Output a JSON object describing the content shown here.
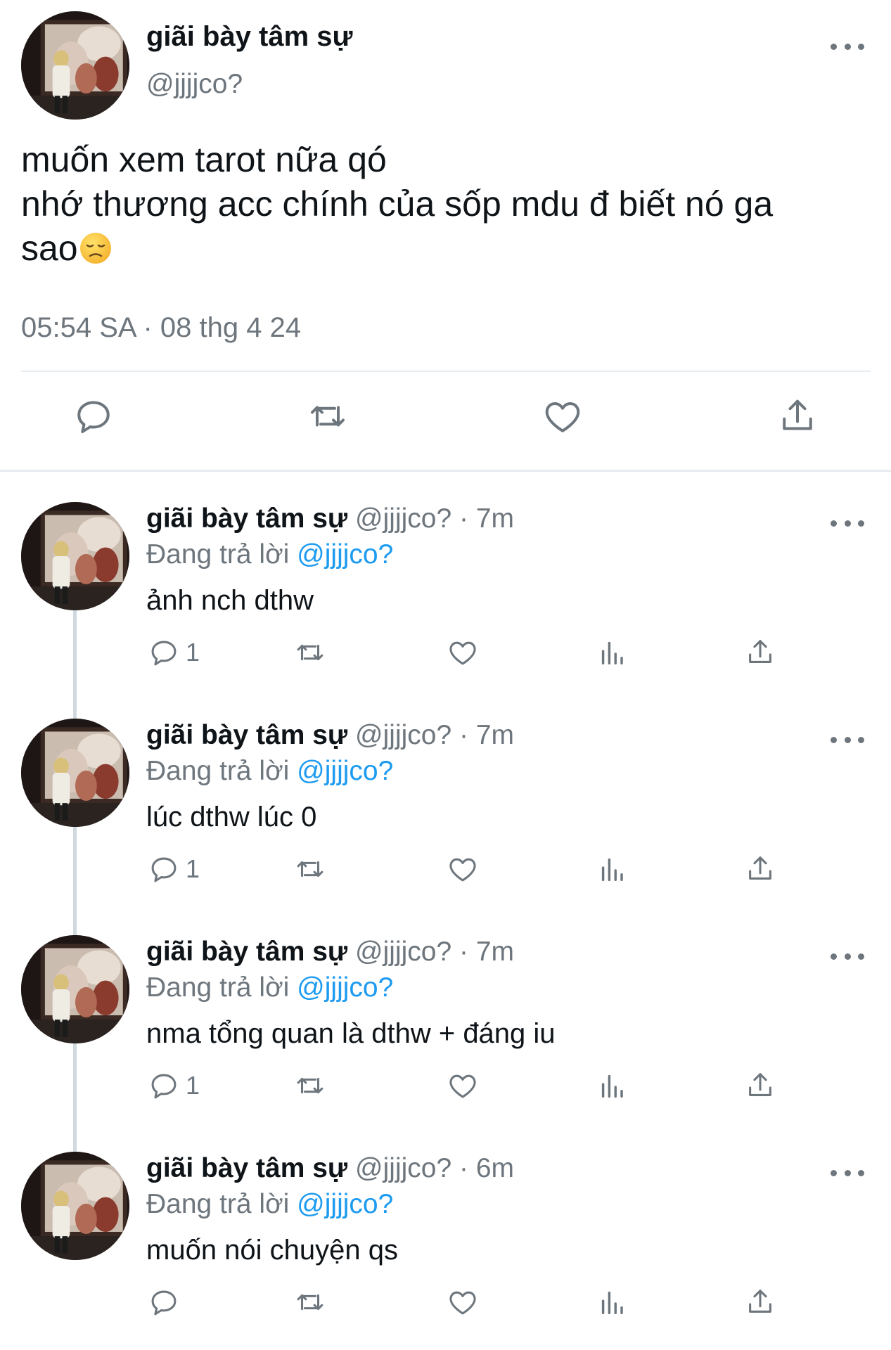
{
  "main": {
    "name": "giãi bày tâm sự",
    "handle": "@jjjjco?",
    "text_lines": [
      "muốn xem tarot nữa qó",
      "nhớ thương acc chính của sốp mdu đ biết nó ga",
      "sao"
    ],
    "emoji": "disappointed-face",
    "timestamp": "05:54 SA · 08 thg 4 24",
    "actions": [
      "reply-icon",
      "retweet-icon",
      "like-icon",
      "share-icon"
    ]
  },
  "replies": [
    {
      "name": "giãi bày tâm sự",
      "handle": "@jjjjco?",
      "dot": "·",
      "time": "7m",
      "replying_prefix": "Đang trả lời",
      "replying_to": "@jjjjco?",
      "text": "ảnh nch dthw",
      "reply_count": "1"
    },
    {
      "name": "giãi bày tâm sự",
      "handle": "@jjjjco?",
      "dot": "·",
      "time": "7m",
      "replying_prefix": "Đang trả lời",
      "replying_to": "@jjjjco?",
      "text": "lúc dthw lúc 0",
      "reply_count": "1"
    },
    {
      "name": "giãi bày tâm sự",
      "handle": "@jjjjco?",
      "dot": "·",
      "time": "7m",
      "replying_prefix": "Đang trả lời",
      "replying_to": "@jjjjco?",
      "text": "nma tổng quan là dthw + đáng iu",
      "reply_count": "1"
    },
    {
      "name": "giãi bày tâm sự",
      "handle": "@jjjjco?",
      "dot": "·",
      "time": "6m",
      "replying_prefix": "Đang trả lời",
      "replying_to": "@jjjjco?",
      "text": "muốn nói chuyện qs",
      "reply_count": ""
    }
  ],
  "colors": {
    "text": "#0f1419",
    "secondary": "#6e767d",
    "link": "#1d9bf0",
    "divider": "#e6ecf0",
    "thread_line": "#cfd9de"
  }
}
